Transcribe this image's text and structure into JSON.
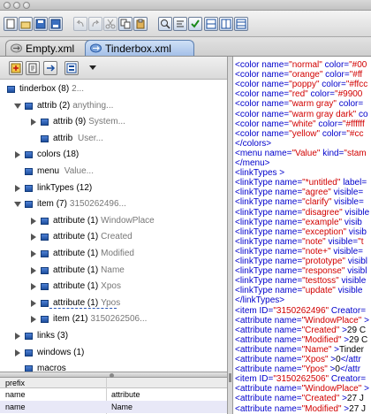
{
  "tabs": [
    {
      "label": "Empty.xml",
      "active": false
    },
    {
      "label": "Tinderbox.xml",
      "active": true
    }
  ],
  "toolbar_icons": [
    "new-doc-icon",
    "open-icon",
    "save-icon",
    "save-as-icon",
    "undo-icon",
    "redo-icon",
    "cut-icon",
    "copy-icon",
    "paste-icon",
    "find-icon",
    "format-icon",
    "validate-icon",
    "split-horizontal-icon",
    "split-vertical-icon",
    "split-full-icon"
  ],
  "left_toolbar_icons": [
    "add-element-icon",
    "add-attribute-icon",
    "add-text-icon",
    "view-options-icon",
    "dropdown-icon"
  ],
  "tree": [
    {
      "name": "tinderbox",
      "count": "(8)",
      "value": "2...",
      "depth": 0,
      "expander": "none"
    },
    {
      "name": "attrib",
      "count": "(2)",
      "value": "anything...",
      "depth": 1,
      "expander": "open"
    },
    {
      "name": "attrib",
      "count": "(9)",
      "value": "System...",
      "depth": 2,
      "expander": "closed"
    },
    {
      "name": "attrib",
      "count": "",
      "value": "User...",
      "depth": 2,
      "expander": "none"
    },
    {
      "name": "colors",
      "count": "(18)",
      "value": "",
      "depth": 1,
      "expander": "closed"
    },
    {
      "name": "menu",
      "count": "",
      "value": "Value...",
      "depth": 1,
      "expander": "none"
    },
    {
      "name": "linkTypes",
      "count": "(12)",
      "value": "",
      "depth": 1,
      "expander": "closed"
    },
    {
      "name": "item",
      "count": "(7)",
      "value": "3150262496...",
      "depth": 1,
      "expander": "open"
    },
    {
      "name": "attribute",
      "count": "(1)",
      "value": "WindowPlace",
      "depth": 2,
      "expander": "closed"
    },
    {
      "name": "attribute",
      "count": "(1)",
      "value": "Created",
      "depth": 2,
      "expander": "closed"
    },
    {
      "name": "attribute",
      "count": "(1)",
      "value": "Modified",
      "depth": 2,
      "expander": "closed"
    },
    {
      "name": "attribute",
      "count": "(1)",
      "value": "Name",
      "depth": 2,
      "expander": "closed"
    },
    {
      "name": "attribute",
      "count": "(1)",
      "value": "Xpos",
      "depth": 2,
      "expander": "closed"
    },
    {
      "name": "attribute",
      "count": "(1)",
      "value": "Ypos",
      "depth": 2,
      "expander": "closed"
    },
    {
      "name": "item",
      "count": "(21)",
      "value": "3150262506...",
      "depth": 2,
      "expander": "closed"
    },
    {
      "name": "links",
      "count": "(3)",
      "value": "",
      "depth": 1,
      "expander": "closed"
    },
    {
      "name": "windows",
      "count": "(1)",
      "value": "",
      "depth": 1,
      "expander": "closed"
    },
    {
      "name": "macros",
      "count": "",
      "value": "",
      "depth": 1,
      "expander": "none"
    }
  ],
  "attr_table": {
    "header": [
      "prefix",
      ""
    ],
    "rows": [
      [
        "name",
        "attribute"
      ],
      [
        "name",
        "Name"
      ]
    ]
  },
  "xml_lines": [
    [
      [
        "b",
        "<color name="
      ],
      [
        "q",
        "\"normal\""
      ],
      [
        "b",
        " color="
      ],
      [
        "q",
        "\"#00"
      ]
    ],
    [
      [
        "b",
        "<color name="
      ],
      [
        "q",
        "\"orange\""
      ],
      [
        "b",
        " color="
      ],
      [
        "q",
        "\"#ff"
      ]
    ],
    [
      [
        "b",
        "<color name="
      ],
      [
        "q",
        "\"poppy\""
      ],
      [
        "b",
        " color="
      ],
      [
        "q",
        "\"#ffcc"
      ]
    ],
    [
      [
        "b",
        "<color name="
      ],
      [
        "q",
        "\"red\""
      ],
      [
        "b",
        " color="
      ],
      [
        "q",
        "\"#9900"
      ]
    ],
    [
      [
        "b",
        "<color name="
      ],
      [
        "q",
        "\"warm gray\""
      ],
      [
        "b",
        " color="
      ]
    ],
    [
      [
        "b",
        "<color name="
      ],
      [
        "q",
        "\"warm gray dark\""
      ],
      [
        "b",
        " co"
      ]
    ],
    [
      [
        "b",
        "<color name="
      ],
      [
        "q",
        "\"white\""
      ],
      [
        "b",
        " color="
      ],
      [
        "q",
        "\"#ffffff"
      ]
    ],
    [
      [
        "b",
        "<color name="
      ],
      [
        "q",
        "\"yellow\""
      ],
      [
        "b",
        " color="
      ],
      [
        "q",
        "\"#cc"
      ]
    ],
    [
      [
        "b",
        "</colors>"
      ]
    ],
    [
      [
        "b",
        "<menu name="
      ],
      [
        "q",
        "\"Value\""
      ],
      [
        "b",
        " kind="
      ],
      [
        "q",
        "\"stam"
      ]
    ],
    [
      [
        "b",
        "</menu>"
      ]
    ],
    [
      [
        "b",
        "<linkTypes >"
      ]
    ],
    [
      [
        "b",
        "<linkType name="
      ],
      [
        "q",
        "\"*untitled\""
      ],
      [
        "b",
        " label="
      ]
    ],
    [
      [
        "b",
        "<linkType name="
      ],
      [
        "q",
        "\"agree\""
      ],
      [
        "b",
        " visible="
      ]
    ],
    [
      [
        "b",
        "<linkType name="
      ],
      [
        "q",
        "\"clarify\""
      ],
      [
        "b",
        " visible="
      ]
    ],
    [
      [
        "b",
        "<linkType name="
      ],
      [
        "q",
        "\"disagree\""
      ],
      [
        "b",
        " visible"
      ]
    ],
    [
      [
        "b",
        "<linkType name="
      ],
      [
        "q",
        "\"example\""
      ],
      [
        "b",
        " visib"
      ]
    ],
    [
      [
        "b",
        "<linkType name="
      ],
      [
        "q",
        "\"exception\""
      ],
      [
        "b",
        " visib"
      ]
    ],
    [
      [
        "b",
        "<linkType name="
      ],
      [
        "q",
        "\"note\""
      ],
      [
        "b",
        " visible="
      ],
      [
        "q",
        "\"t"
      ]
    ],
    [
      [
        "b",
        "<linkType name="
      ],
      [
        "q",
        "\"note+\""
      ],
      [
        "b",
        " visible="
      ]
    ],
    [
      [
        "b",
        "<linkType name="
      ],
      [
        "q",
        "\"prototype\""
      ],
      [
        "b",
        " visibl"
      ]
    ],
    [
      [
        "b",
        "<linkType name="
      ],
      [
        "q",
        "\"response\""
      ],
      [
        "b",
        " visibl"
      ]
    ],
    [
      [
        "b",
        "<linkType name="
      ],
      [
        "q",
        "\"testtoss\""
      ],
      [
        "b",
        " visible"
      ]
    ],
    [
      [
        "b",
        "<linkType name="
      ],
      [
        "q",
        "\"update\""
      ],
      [
        "b",
        " visible"
      ]
    ],
    [
      [
        "b",
        "</linkTypes>"
      ]
    ],
    [
      [
        "b",
        "<item ID="
      ],
      [
        "q",
        "\"3150262496\""
      ],
      [
        "b",
        " Creator="
      ]
    ],
    [
      [
        "b",
        "<attribute name="
      ],
      [
        "q",
        "\"WindowPlace\""
      ],
      [
        "b",
        " >"
      ]
    ],
    [
      [
        "b",
        "<attribute name="
      ],
      [
        "q",
        "\"Created\""
      ],
      [
        "b",
        " >"
      ],
      [
        "t",
        "29 C"
      ]
    ],
    [
      [
        "b",
        "<attribute name="
      ],
      [
        "q",
        "\"Modified\""
      ],
      [
        "b",
        " >"
      ],
      [
        "t",
        "29 C"
      ]
    ],
    [
      [
        "b",
        "<attribute name="
      ],
      [
        "q",
        "\"Name\""
      ],
      [
        "b",
        " >"
      ],
      [
        "t",
        "Tinder"
      ]
    ],
    [
      [
        "b",
        "<attribute name="
      ],
      [
        "q",
        "\"Xpos\""
      ],
      [
        "b",
        " >"
      ],
      [
        "t",
        "0"
      ],
      [
        "b",
        "</attr"
      ]
    ],
    [
      [
        "b",
        "<attribute name="
      ],
      [
        "q",
        "\"Ypos\""
      ],
      [
        "b",
        " >"
      ],
      [
        "t",
        "0"
      ],
      [
        "b",
        "</attr"
      ]
    ],
    [
      [
        "b",
        "<item ID="
      ],
      [
        "q",
        "\"3150262506\""
      ],
      [
        "b",
        " Creator="
      ]
    ],
    [
      [
        "b",
        "<attribute name="
      ],
      [
        "q",
        "\"WindowPlace\""
      ],
      [
        "b",
        " >"
      ]
    ],
    [
      [
        "b",
        "<attribute name="
      ],
      [
        "q",
        "\"Created\""
      ],
      [
        "b",
        " >"
      ],
      [
        "t",
        "27 J"
      ]
    ],
    [
      [
        "b",
        "<attribute name="
      ],
      [
        "q",
        "\"Modified\""
      ],
      [
        "b",
        " >"
      ],
      [
        "t",
        "27 J"
      ]
    ]
  ]
}
